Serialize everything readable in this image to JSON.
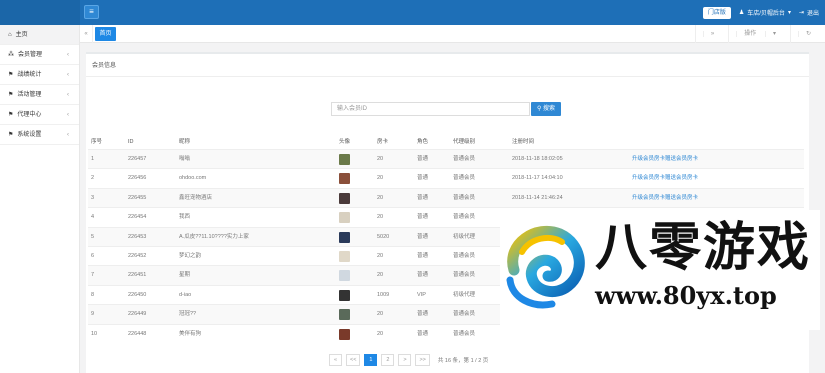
{
  "header": {
    "menu_icon": "menu-icon",
    "store_button": "门店版",
    "user_label": "车店/贝帽后台",
    "logout_label": "退出"
  },
  "sidebar": {
    "items": [
      {
        "label": "主页",
        "icon": "home-icon"
      },
      {
        "label": "会员管理",
        "icon": "users-icon"
      },
      {
        "label": "战绩统计",
        "icon": "flag-icon"
      },
      {
        "label": "活动管理",
        "icon": "flag-icon"
      },
      {
        "label": "代理中心",
        "icon": "flag-icon"
      },
      {
        "label": "系统设置",
        "icon": "flag-icon"
      }
    ]
  },
  "tabs": {
    "active": "首页",
    "actions": "操作"
  },
  "panel": {
    "title": "会员信息",
    "search_placeholder": "输入会员ID",
    "search_button": "搜索"
  },
  "table": {
    "columns": [
      "序号",
      "ID",
      "昵称",
      "头像",
      "房卡",
      "角色",
      "代理级别",
      "注册时间",
      ""
    ],
    "rows": [
      [
        "1",
        "226457",
        "嗡嗡",
        "",
        "20",
        "普通",
        "普通会员",
        "2018-11-18 18:02:05",
        "升级会员房卡赠送会员房卡"
      ],
      [
        "2",
        "226456",
        "ohdoo.com",
        "",
        "20",
        "普通",
        "普通会员",
        "2018-11-17 14:04:10",
        "升级会员房卡赠送会员房卡"
      ],
      [
        "3",
        "226455",
        "鑫旺宠物酒店",
        "",
        "20",
        "普通",
        "普通会员",
        "2018-11-14 21:46:24",
        "升级会员房卡赠送会员房卡"
      ],
      [
        "4",
        "226454",
        "我西",
        "",
        "20",
        "普通",
        "普通会员",
        "",
        ""
      ],
      [
        "5",
        "226453",
        "A.瓜皮??11.10????实力上家",
        "",
        "5020",
        "普通",
        "初级代理",
        "",
        ""
      ],
      [
        "6",
        "226452",
        "梦幻之韵",
        "",
        "20",
        "普通",
        "普通会员",
        "",
        ""
      ],
      [
        "7",
        "226451",
        "星期",
        "",
        "20",
        "普通",
        "普通会员",
        "",
        ""
      ],
      [
        "8",
        "226450",
        "d-iao",
        "",
        "1009",
        "VIP",
        "初级代理",
        "",
        ""
      ],
      [
        "9",
        "226449",
        "冠冠??",
        "",
        "20",
        "普通",
        "普通会员",
        "",
        ""
      ],
      [
        "10",
        "226448",
        "美伴有狗",
        "",
        "20",
        "普通",
        "普通会员",
        "",
        ""
      ]
    ]
  },
  "pagination": {
    "first": "«",
    "prev": "<<",
    "pages": [
      "1",
      "2"
    ],
    "next": ">",
    "last": ">>",
    "info": "共 16 条，第 1 / 2 页"
  },
  "watermark": {
    "title": "八零游戏",
    "url": "www.80yx.top"
  }
}
